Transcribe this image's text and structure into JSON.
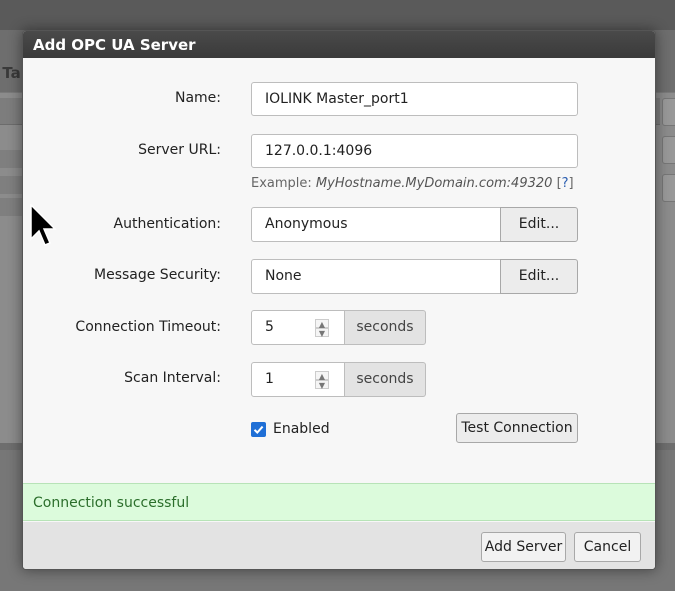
{
  "background": {
    "partial_title": "l Ta"
  },
  "dialog": {
    "title": "Add OPC UA Server",
    "fields": {
      "name": {
        "label": "Name:",
        "value": "IOLINK Master_port1"
      },
      "server_url": {
        "label": "Server URL:",
        "value": "127.0.0.1:4096",
        "example_prefix": "Example:",
        "example_value": "MyHostname.MyDomain.com:49320",
        "help_open": "[",
        "help_link": "?",
        "help_close": "]"
      },
      "authentication": {
        "label": "Authentication:",
        "value": "Anonymous",
        "edit_label": "Edit..."
      },
      "message_security": {
        "label": "Message Security:",
        "value": "None",
        "edit_label": "Edit..."
      },
      "connection_timeout": {
        "label": "Connection Timeout:",
        "value": "5",
        "unit": "seconds"
      },
      "scan_interval": {
        "label": "Scan Interval:",
        "value": "1",
        "unit": "seconds"
      }
    },
    "enabled": {
      "label": "Enabled",
      "checked": true
    },
    "test_connection_label": "Test Connection",
    "status_message": "Connection successful",
    "status_color": "#dcfbdc",
    "add_server_label": "Add Server",
    "cancel_label": "Cancel"
  },
  "icons": {
    "cursor": "mouse-pointer-icon",
    "spin_up": "chevron-up-icon",
    "spin_down": "chevron-down-icon",
    "checkbox": "check-icon"
  }
}
